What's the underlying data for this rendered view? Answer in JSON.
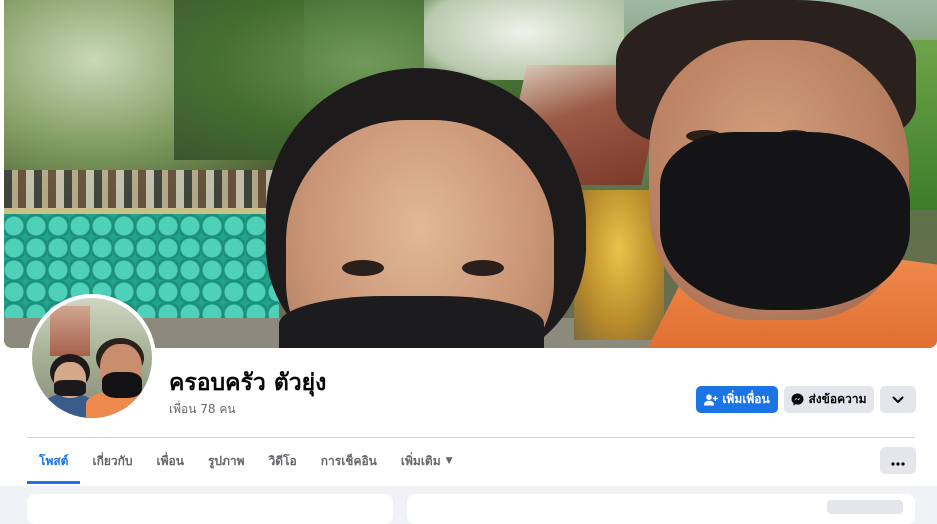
{
  "profile": {
    "name": "ครอบครัว ตัวยุ่ง",
    "friends_text": "เพื่อน 78 คน"
  },
  "actions": {
    "add_friend_label": "เพิ่มเพื่อน",
    "add_friend_icon": "person-add-icon",
    "message_label": "ส่งข้อความ",
    "message_icon": "messenger-icon",
    "more_icon": "chevron-down-icon"
  },
  "tabs": [
    {
      "label": "โพสต์",
      "active": true
    },
    {
      "label": "เกี่ยวกับ",
      "active": false
    },
    {
      "label": "เพื่อน",
      "active": false
    },
    {
      "label": "รูปภาพ",
      "active": false
    },
    {
      "label": "วิดีโอ",
      "active": false
    },
    {
      "label": "การเช็คอิน",
      "active": false
    },
    {
      "label": "เพิ่มเติม",
      "active": false,
      "dropdown": true
    }
  ],
  "tab_overflow_icon": "more-horizontal-icon",
  "colors": {
    "primary": "#1b74e4",
    "secondary_button": "#e4e6eb",
    "secondary_text": "#65676b",
    "page_background": "#f0f2f5"
  }
}
